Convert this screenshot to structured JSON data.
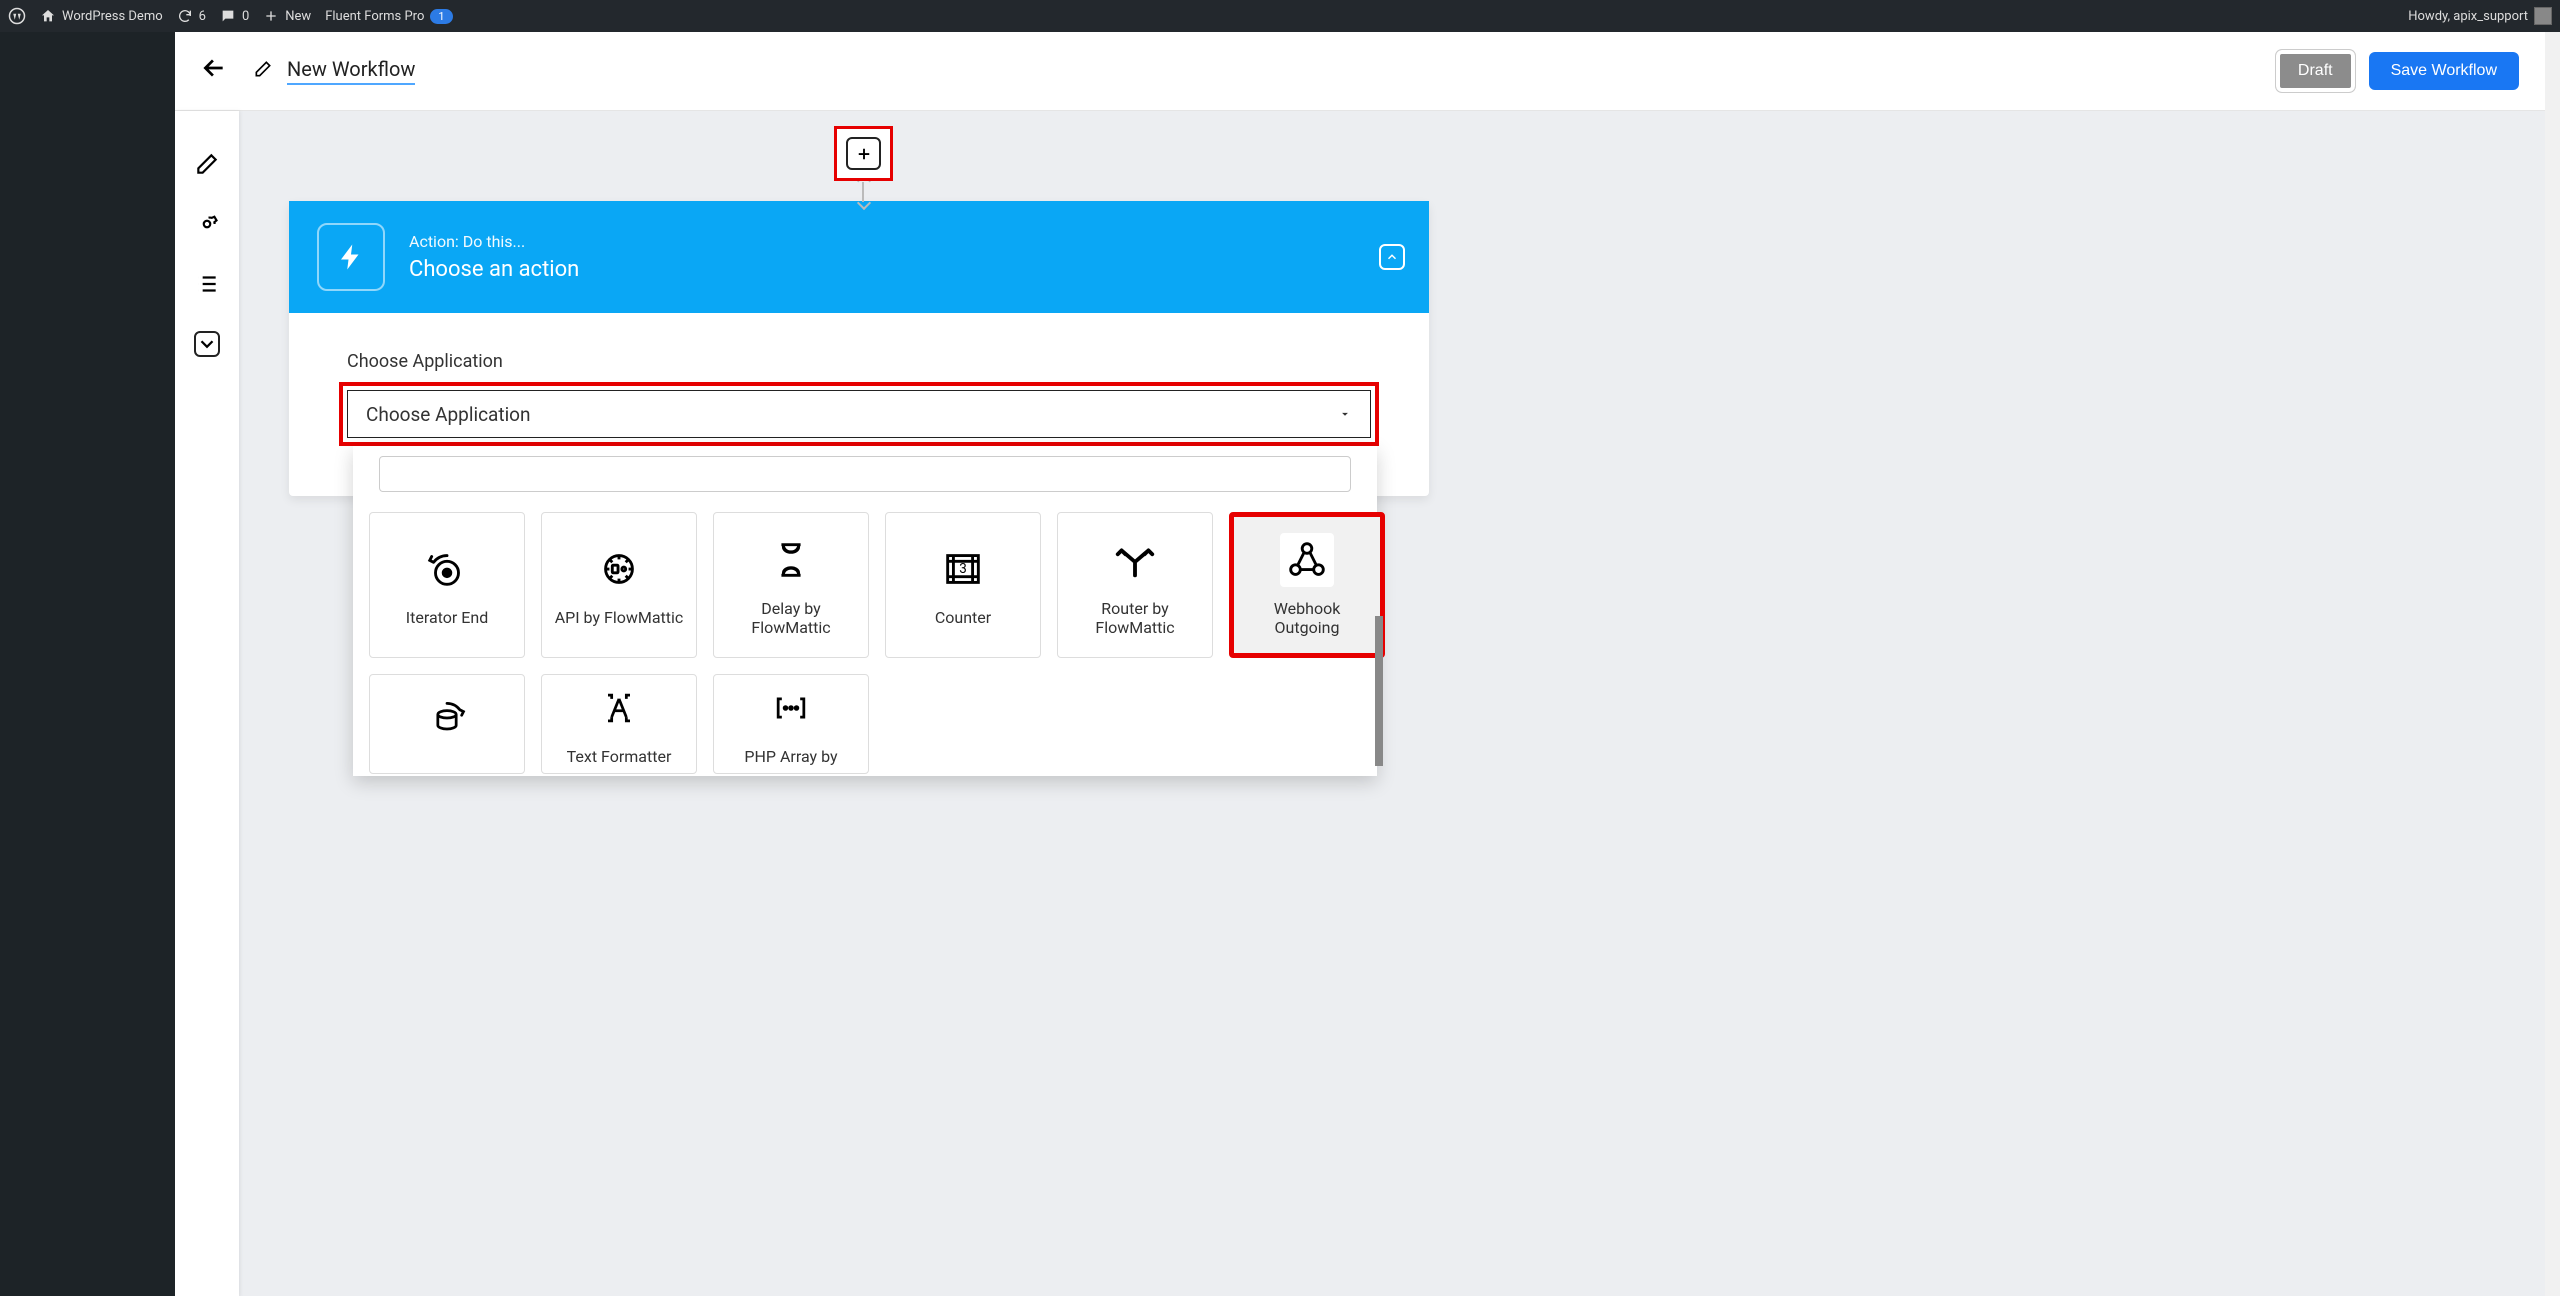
{
  "adminbar": {
    "site_name": "WordPress Demo",
    "updates": "6",
    "comments": "0",
    "new": "New",
    "fluent_forms": "Fluent Forms Pro",
    "fluent_badge": "1",
    "howdy": "Howdy, apix_support"
  },
  "header": {
    "workflow_title": "New Workflow",
    "draft": "Draft",
    "save": "Save Workflow"
  },
  "action_card": {
    "line1": "Action: Do this...",
    "line2": "Choose an action",
    "field_label": "Choose Application",
    "select_placeholder": "Choose Application"
  },
  "dropdown": {
    "search_placeholder": "",
    "apps_row1": [
      {
        "label": "Iterator End"
      },
      {
        "label": "API by FlowMattic"
      },
      {
        "label": "Delay by FlowMattic"
      },
      {
        "label": "Counter"
      },
      {
        "label": "Router by FlowMattic"
      },
      {
        "label": "Webhook Outgoing",
        "highlight": true
      }
    ],
    "apps_row2": [
      {
        "label": ""
      },
      {
        "label": "Text Formatter"
      },
      {
        "label": "PHP Array by"
      }
    ]
  }
}
